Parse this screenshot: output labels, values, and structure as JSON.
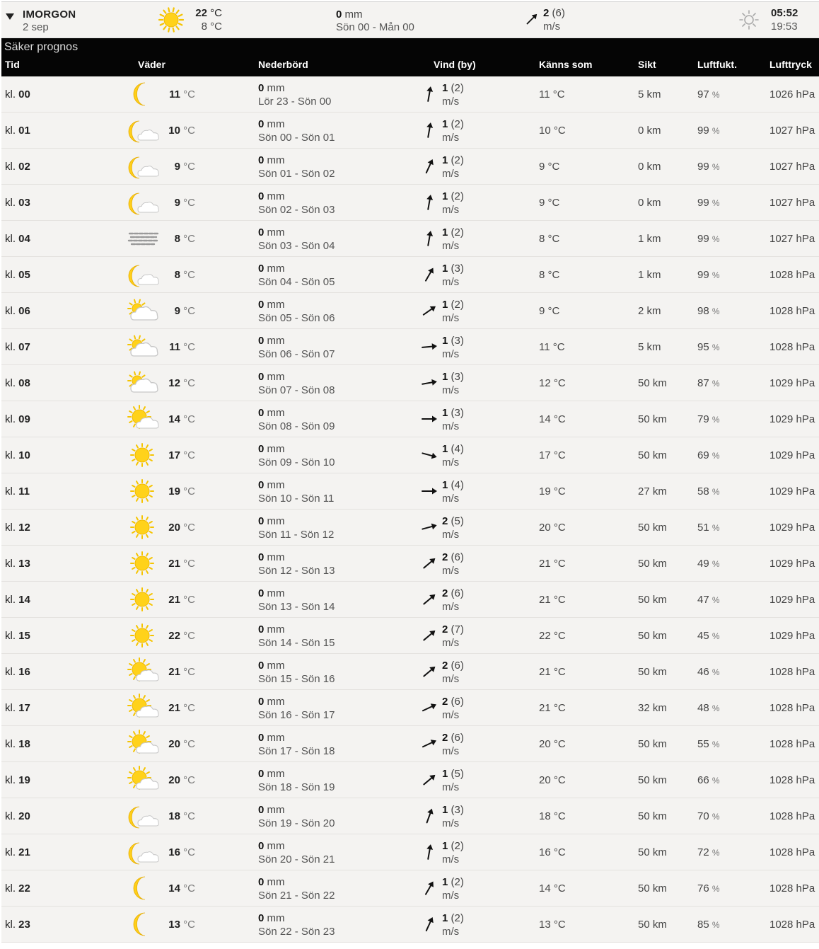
{
  "day": {
    "title": "IMORGON",
    "date": "2 sep",
    "icon": "sun",
    "temp_max": "22",
    "temp_min": "8",
    "temp_unit": "°C",
    "precip_value": "0",
    "precip_unit": "mm",
    "precip_period": "Sön 00 - Mån 00",
    "wind_direction_deg": 45,
    "wind_speed": "2",
    "wind_gust": "(6)",
    "wind_unit": "m/s",
    "sunrise": "05:52",
    "sunset": "19:53"
  },
  "table": {
    "forecast_label": "Säker prognos",
    "columns": {
      "time": "Tid",
      "weather": "Väder",
      "precip": "Nederbörd",
      "wind": "Vind (by)",
      "feels": "Känns som",
      "visibility": "Sikt",
      "humidity": "Luftfukt.",
      "pressure": "Lufttryck"
    },
    "units": {
      "temp": "°C",
      "precip": "mm",
      "wind": "m/s",
      "visibility": "km",
      "humidity": "%",
      "pressure": "hPa"
    },
    "time_prefix": "kl.",
    "rows": [
      {
        "hour": "00",
        "icon": "moon",
        "temp": "11",
        "precip": "0",
        "period": "Lör 23 - Sön 00",
        "wind": "1",
        "gust": "(2)",
        "dir": 10,
        "feels": "11",
        "vis": "5",
        "hum": "97",
        "pres": "1026"
      },
      {
        "hour": "01",
        "icon": "moon-cloud",
        "temp": "10",
        "precip": "0",
        "period": "Sön 00 - Sön 01",
        "wind": "1",
        "gust": "(2)",
        "dir": 10,
        "feels": "10",
        "vis": "0",
        "hum": "99",
        "pres": "1027"
      },
      {
        "hour": "02",
        "icon": "moon-cloud",
        "temp": "9",
        "precip": "0",
        "period": "Sön 01 - Sön 02",
        "wind": "1",
        "gust": "(2)",
        "dir": 25,
        "feels": "9",
        "vis": "0",
        "hum": "99",
        "pres": "1027"
      },
      {
        "hour": "03",
        "icon": "moon-cloud",
        "temp": "9",
        "precip": "0",
        "period": "Sön 02 - Sön 03",
        "wind": "1",
        "gust": "(2)",
        "dir": 10,
        "feels": "9",
        "vis": "0",
        "hum": "99",
        "pres": "1027"
      },
      {
        "hour": "04",
        "icon": "fog",
        "temp": "8",
        "precip": "0",
        "period": "Sön 03 - Sön 04",
        "wind": "1",
        "gust": "(2)",
        "dir": 10,
        "feels": "8",
        "vis": "1",
        "hum": "99",
        "pres": "1027"
      },
      {
        "hour": "05",
        "icon": "moon-cloud",
        "temp": "8",
        "precip": "0",
        "period": "Sön 04 - Sön 05",
        "wind": "1",
        "gust": "(3)",
        "dir": 30,
        "feels": "8",
        "vis": "1",
        "hum": "99",
        "pres": "1028"
      },
      {
        "hour": "06",
        "icon": "sun-cloud-small",
        "temp": "9",
        "precip": "0",
        "period": "Sön 05 - Sön 06",
        "wind": "1",
        "gust": "(2)",
        "dir": 55,
        "feels": "9",
        "vis": "2",
        "hum": "98",
        "pres": "1028"
      },
      {
        "hour": "07",
        "icon": "sun-cloud-small",
        "temp": "11",
        "precip": "0",
        "period": "Sön 06 - Sön 07",
        "wind": "1",
        "gust": "(3)",
        "dir": 85,
        "feels": "11",
        "vis": "5",
        "hum": "95",
        "pres": "1028"
      },
      {
        "hour": "08",
        "icon": "sun-cloud-small",
        "temp": "12",
        "precip": "0",
        "period": "Sön 07 - Sön 08",
        "wind": "1",
        "gust": "(3)",
        "dir": 80,
        "feels": "12",
        "vis": "50",
        "hum": "87",
        "pres": "1029"
      },
      {
        "hour": "09",
        "icon": "sun-cloud",
        "temp": "14",
        "precip": "0",
        "period": "Sön 08 - Sön 09",
        "wind": "1",
        "gust": "(3)",
        "dir": 90,
        "feels": "14",
        "vis": "50",
        "hum": "79",
        "pres": "1029"
      },
      {
        "hour": "10",
        "icon": "sun",
        "temp": "17",
        "precip": "0",
        "period": "Sön 09 - Sön 10",
        "wind": "1",
        "gust": "(4)",
        "dir": 105,
        "feels": "17",
        "vis": "50",
        "hum": "69",
        "pres": "1029"
      },
      {
        "hour": "11",
        "icon": "sun",
        "temp": "19",
        "precip": "0",
        "period": "Sön 10 - Sön 11",
        "wind": "1",
        "gust": "(4)",
        "dir": 90,
        "feels": "19",
        "vis": "27",
        "hum": "58",
        "pres": "1029"
      },
      {
        "hour": "12",
        "icon": "sun",
        "temp": "20",
        "precip": "0",
        "period": "Sön 11 - Sön 12",
        "wind": "2",
        "gust": "(5)",
        "dir": 75,
        "feels": "20",
        "vis": "50",
        "hum": "51",
        "pres": "1029"
      },
      {
        "hour": "13",
        "icon": "sun",
        "temp": "21",
        "precip": "0",
        "period": "Sön 12 - Sön 13",
        "wind": "2",
        "gust": "(6)",
        "dir": 50,
        "feels": "21",
        "vis": "50",
        "hum": "49",
        "pres": "1029"
      },
      {
        "hour": "14",
        "icon": "sun",
        "temp": "21",
        "precip": "0",
        "period": "Sön 13 - Sön 14",
        "wind": "2",
        "gust": "(6)",
        "dir": 50,
        "feels": "21",
        "vis": "50",
        "hum": "47",
        "pres": "1029"
      },
      {
        "hour": "15",
        "icon": "sun",
        "temp": "22",
        "precip": "0",
        "period": "Sön 14 - Sön 15",
        "wind": "2",
        "gust": "(7)",
        "dir": 50,
        "feels": "22",
        "vis": "50",
        "hum": "45",
        "pres": "1029"
      },
      {
        "hour": "16",
        "icon": "sun-cloud",
        "temp": "21",
        "precip": "0",
        "period": "Sön 15 - Sön 16",
        "wind": "2",
        "gust": "(6)",
        "dir": 50,
        "feels": "21",
        "vis": "50",
        "hum": "46",
        "pres": "1028"
      },
      {
        "hour": "17",
        "icon": "sun-cloud",
        "temp": "21",
        "precip": "0",
        "period": "Sön 16 - Sön 17",
        "wind": "2",
        "gust": "(6)",
        "dir": 65,
        "feels": "21",
        "vis": "32",
        "hum": "48",
        "pres": "1028"
      },
      {
        "hour": "18",
        "icon": "sun-cloud",
        "temp": "20",
        "precip": "0",
        "period": "Sön 17 - Sön 18",
        "wind": "2",
        "gust": "(6)",
        "dir": 65,
        "feels": "20",
        "vis": "50",
        "hum": "55",
        "pres": "1028"
      },
      {
        "hour": "19",
        "icon": "sun-cloud",
        "temp": "20",
        "precip": "0",
        "period": "Sön 18 - Sön 19",
        "wind": "1",
        "gust": "(5)",
        "dir": 50,
        "feels": "20",
        "vis": "50",
        "hum": "66",
        "pres": "1028"
      },
      {
        "hour": "20",
        "icon": "moon-cloud",
        "temp": "18",
        "precip": "0",
        "period": "Sön 19 - Sön 20",
        "wind": "1",
        "gust": "(3)",
        "dir": 20,
        "feels": "18",
        "vis": "50",
        "hum": "70",
        "pres": "1028"
      },
      {
        "hour": "21",
        "icon": "moon-cloud",
        "temp": "16",
        "precip": "0",
        "period": "Sön 20 - Sön 21",
        "wind": "1",
        "gust": "(2)",
        "dir": 10,
        "feels": "16",
        "vis": "50",
        "hum": "72",
        "pres": "1028"
      },
      {
        "hour": "22",
        "icon": "moon",
        "temp": "14",
        "precip": "0",
        "period": "Sön 21 - Sön 22",
        "wind": "1",
        "gust": "(2)",
        "dir": 30,
        "feels": "14",
        "vis": "50",
        "hum": "76",
        "pres": "1028"
      },
      {
        "hour": "23",
        "icon": "moon",
        "temp": "13",
        "precip": "0",
        "period": "Sön 22 - Sön 23",
        "wind": "1",
        "gust": "(2)",
        "dir": 25,
        "feels": "13",
        "vis": "50",
        "hum": "85",
        "pres": "1028"
      }
    ]
  }
}
